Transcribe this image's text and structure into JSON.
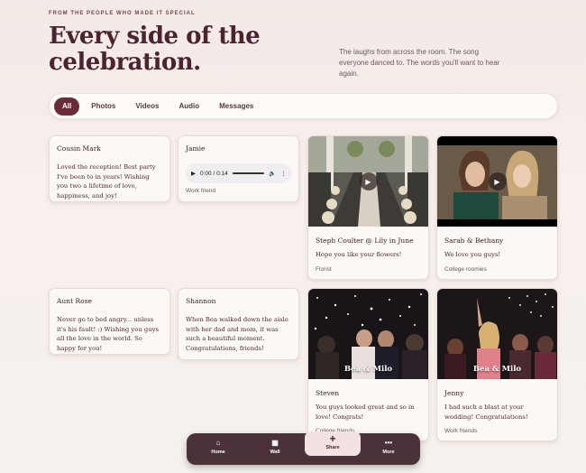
{
  "hero": {
    "eyebrow": "FROM THE PEOPLE WHO MADE IT SPECIAL",
    "title": "Every side of the celebration.",
    "description": "The laughs from across the room. The song everyone danced to. The words you'll want to hear again."
  },
  "filters": [
    "All",
    "Photos",
    "Videos",
    "Audio",
    "Messages"
  ],
  "cards": {
    "cousin_mark": {
      "name": "Cousin Mark",
      "message": "Loved the reception! Best party I've been to in years! Wishing you two a lifetime of love, happiness, and joy!"
    },
    "jamie": {
      "name": "Jamie",
      "audio_time": "0:00 / 0:14",
      "relation": "Work friend"
    },
    "steph": {
      "name": "Steph Coulter @ Lily in June",
      "message": "Hope you like your flowers!",
      "relation": "Florist"
    },
    "sarah": {
      "name": "Sarah & Bethany",
      "message": "We love you guys!",
      "relation": "College roomies"
    },
    "aunt_rose": {
      "name": "Aunt Rose",
      "message": "Never go to bed angry... unless it's his fault! :) Wishing you guys all the love in the world. So happy for you!"
    },
    "shannon": {
      "name": "Shannon",
      "message": "When Bea walked down the aisle with her dad and mom, it was such a beautiful moment. Congratulations, friends!"
    },
    "steven": {
      "name": "Steven",
      "message": "You guys looked great and so in love! Congrats!",
      "relation": "College friends",
      "overlay": "Bea & Milo"
    },
    "jenny": {
      "name": "Jenny",
      "message": "I had such a blast at your wedding! Congratulations!",
      "relation": "Work friends",
      "overlay": "Bea & Milo"
    }
  },
  "nav": {
    "home": "Home",
    "wall": "Wall",
    "share": "Share",
    "more": "More"
  },
  "icons": {
    "home": "home-icon",
    "wall": "grid-icon",
    "share": "plus-icon",
    "more": "dots-icon"
  },
  "colors": {
    "accent": "#6b2c3a",
    "nav_bg": "#4b3238",
    "share_bg": "#f3e1e3"
  }
}
